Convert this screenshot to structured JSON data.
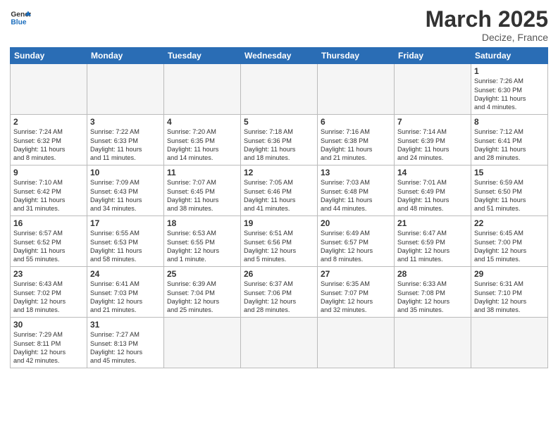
{
  "header": {
    "logo_general": "General",
    "logo_blue": "Blue",
    "month_title": "March 2025",
    "location": "Decize, France"
  },
  "weekdays": [
    "Sunday",
    "Monday",
    "Tuesday",
    "Wednesday",
    "Thursday",
    "Friday",
    "Saturday"
  ],
  "weeks": [
    [
      {
        "day": "",
        "info": ""
      },
      {
        "day": "",
        "info": ""
      },
      {
        "day": "",
        "info": ""
      },
      {
        "day": "",
        "info": ""
      },
      {
        "day": "",
        "info": ""
      },
      {
        "day": "",
        "info": ""
      },
      {
        "day": "1",
        "info": "Sunrise: 7:26 AM\nSunset: 6:30 PM\nDaylight: 11 hours\nand 4 minutes."
      }
    ],
    [
      {
        "day": "2",
        "info": "Sunrise: 7:24 AM\nSunset: 6:32 PM\nDaylight: 11 hours\nand 8 minutes."
      },
      {
        "day": "3",
        "info": "Sunrise: 7:22 AM\nSunset: 6:33 PM\nDaylight: 11 hours\nand 11 minutes."
      },
      {
        "day": "4",
        "info": "Sunrise: 7:20 AM\nSunset: 6:35 PM\nDaylight: 11 hours\nand 14 minutes."
      },
      {
        "day": "5",
        "info": "Sunrise: 7:18 AM\nSunset: 6:36 PM\nDaylight: 11 hours\nand 18 minutes."
      },
      {
        "day": "6",
        "info": "Sunrise: 7:16 AM\nSunset: 6:38 PM\nDaylight: 11 hours\nand 21 minutes."
      },
      {
        "day": "7",
        "info": "Sunrise: 7:14 AM\nSunset: 6:39 PM\nDaylight: 11 hours\nand 24 minutes."
      },
      {
        "day": "8",
        "info": "Sunrise: 7:12 AM\nSunset: 6:41 PM\nDaylight: 11 hours\nand 28 minutes."
      }
    ],
    [
      {
        "day": "9",
        "info": "Sunrise: 7:10 AM\nSunset: 6:42 PM\nDaylight: 11 hours\nand 31 minutes."
      },
      {
        "day": "10",
        "info": "Sunrise: 7:09 AM\nSunset: 6:43 PM\nDaylight: 11 hours\nand 34 minutes."
      },
      {
        "day": "11",
        "info": "Sunrise: 7:07 AM\nSunset: 6:45 PM\nDaylight: 11 hours\nand 38 minutes."
      },
      {
        "day": "12",
        "info": "Sunrise: 7:05 AM\nSunset: 6:46 PM\nDaylight: 11 hours\nand 41 minutes."
      },
      {
        "day": "13",
        "info": "Sunrise: 7:03 AM\nSunset: 6:48 PM\nDaylight: 11 hours\nand 44 minutes."
      },
      {
        "day": "14",
        "info": "Sunrise: 7:01 AM\nSunset: 6:49 PM\nDaylight: 11 hours\nand 48 minutes."
      },
      {
        "day": "15",
        "info": "Sunrise: 6:59 AM\nSunset: 6:50 PM\nDaylight: 11 hours\nand 51 minutes."
      }
    ],
    [
      {
        "day": "16",
        "info": "Sunrise: 6:57 AM\nSunset: 6:52 PM\nDaylight: 11 hours\nand 55 minutes."
      },
      {
        "day": "17",
        "info": "Sunrise: 6:55 AM\nSunset: 6:53 PM\nDaylight: 11 hours\nand 58 minutes."
      },
      {
        "day": "18",
        "info": "Sunrise: 6:53 AM\nSunset: 6:55 PM\nDaylight: 12 hours\nand 1 minute."
      },
      {
        "day": "19",
        "info": "Sunrise: 6:51 AM\nSunset: 6:56 PM\nDaylight: 12 hours\nand 5 minutes."
      },
      {
        "day": "20",
        "info": "Sunrise: 6:49 AM\nSunset: 6:57 PM\nDaylight: 12 hours\nand 8 minutes."
      },
      {
        "day": "21",
        "info": "Sunrise: 6:47 AM\nSunset: 6:59 PM\nDaylight: 12 hours\nand 11 minutes."
      },
      {
        "day": "22",
        "info": "Sunrise: 6:45 AM\nSunset: 7:00 PM\nDaylight: 12 hours\nand 15 minutes."
      }
    ],
    [
      {
        "day": "23",
        "info": "Sunrise: 6:43 AM\nSunset: 7:02 PM\nDaylight: 12 hours\nand 18 minutes."
      },
      {
        "day": "24",
        "info": "Sunrise: 6:41 AM\nSunset: 7:03 PM\nDaylight: 12 hours\nand 21 minutes."
      },
      {
        "day": "25",
        "info": "Sunrise: 6:39 AM\nSunset: 7:04 PM\nDaylight: 12 hours\nand 25 minutes."
      },
      {
        "day": "26",
        "info": "Sunrise: 6:37 AM\nSunset: 7:06 PM\nDaylight: 12 hours\nand 28 minutes."
      },
      {
        "day": "27",
        "info": "Sunrise: 6:35 AM\nSunset: 7:07 PM\nDaylight: 12 hours\nand 32 minutes."
      },
      {
        "day": "28",
        "info": "Sunrise: 6:33 AM\nSunset: 7:08 PM\nDaylight: 12 hours\nand 35 minutes."
      },
      {
        "day": "29",
        "info": "Sunrise: 6:31 AM\nSunset: 7:10 PM\nDaylight: 12 hours\nand 38 minutes."
      }
    ],
    [
      {
        "day": "30",
        "info": "Sunrise: 7:29 AM\nSunset: 8:11 PM\nDaylight: 12 hours\nand 42 minutes."
      },
      {
        "day": "31",
        "info": "Sunrise: 7:27 AM\nSunset: 8:13 PM\nDaylight: 12 hours\nand 45 minutes."
      },
      {
        "day": "",
        "info": ""
      },
      {
        "day": "",
        "info": ""
      },
      {
        "day": "",
        "info": ""
      },
      {
        "day": "",
        "info": ""
      },
      {
        "day": "",
        "info": ""
      }
    ]
  ]
}
